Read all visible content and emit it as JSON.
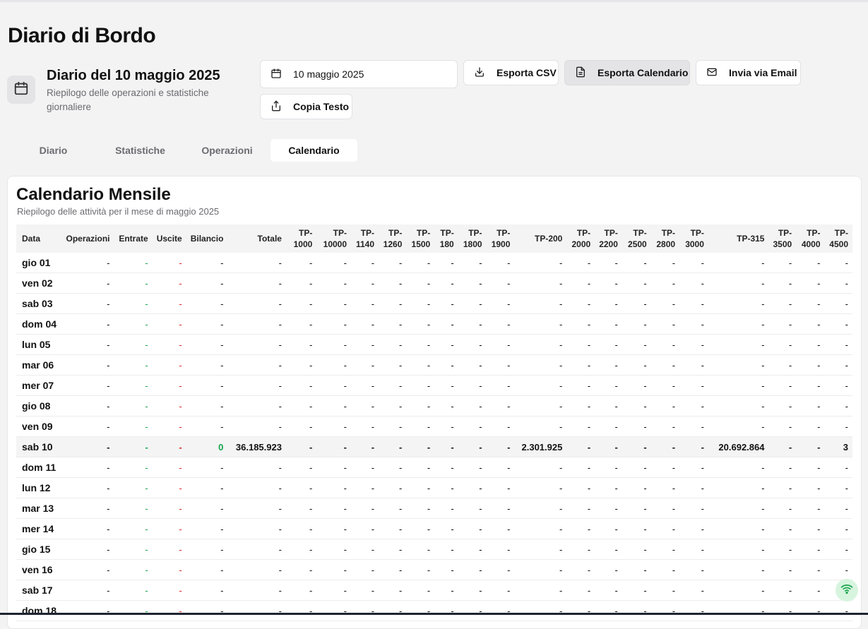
{
  "page": {
    "title": "Diario di Bordo"
  },
  "header": {
    "diary_title": "Diario del 10 maggio 2025",
    "diary_subtitle": "Riepilogo delle operazioni e statistiche giornaliere"
  },
  "toolbar": {
    "date_value": "10 maggio 2025",
    "export_csv": "Esporta CSV",
    "export_calendar": "Esporta Calendario",
    "send_email": "Invia via Email",
    "copy_text": "Copia Testo"
  },
  "tabs": [
    {
      "label": "Diario",
      "active": false
    },
    {
      "label": "Statistiche",
      "active": false
    },
    {
      "label": "Operazioni",
      "active": false
    },
    {
      "label": "Calendario",
      "active": true
    }
  ],
  "calendar": {
    "title": "Calendario Mensile",
    "subtitle": "Riepilogo delle attività per il mese di maggio 2025",
    "columns": [
      "Data",
      "Operazioni",
      "Entrate",
      "Uscite",
      "Bilancio",
      "Totale",
      "TP-1000",
      "TP-10000",
      "TP-1140",
      "TP-1260",
      "TP-1500",
      "TP-180",
      "TP-1800",
      "TP-1900",
      "TP-200",
      "TP-2000",
      "TP-2200",
      "TP-2500",
      "TP-2800",
      "TP-3000",
      "TP-315",
      "TP-3500",
      "TP-4000",
      "TP-4500"
    ],
    "rows": [
      {
        "day": "gio 01"
      },
      {
        "day": "ven 02"
      },
      {
        "day": "sab 03"
      },
      {
        "day": "dom 04"
      },
      {
        "day": "lun 05"
      },
      {
        "day": "mar 06"
      },
      {
        "day": "mer 07"
      },
      {
        "day": "gio 08"
      },
      {
        "day": "ven 09"
      },
      {
        "day": "sab 10",
        "highlight": true,
        "bilancio": "0",
        "totale": "36.185.923",
        "tp200": "2.301.925",
        "tp315": "20.692.864",
        "tp4500": "3"
      },
      {
        "day": "dom 11"
      },
      {
        "day": "lun 12"
      },
      {
        "day": "mar 13"
      },
      {
        "day": "mer 14"
      },
      {
        "day": "gio 15"
      },
      {
        "day": "ven 16"
      },
      {
        "day": "sab 17"
      },
      {
        "day": "dom 18"
      }
    ],
    "empty": "-"
  },
  "colors": {
    "positive": "#16a34a",
    "negative": "#dc2626",
    "accent_bg": "#e4e4e7"
  },
  "icons": [
    "calendar-icon",
    "download-icon",
    "file-icon",
    "mail-icon",
    "share-icon",
    "wifi-icon"
  ]
}
